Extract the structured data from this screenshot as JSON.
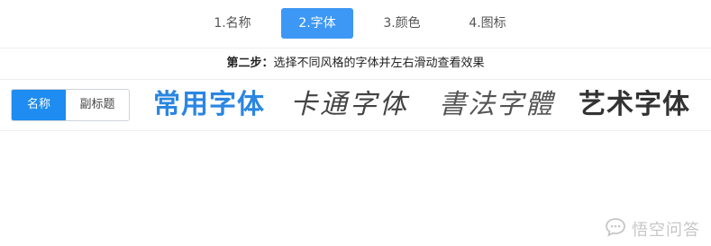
{
  "steps": [
    {
      "label": "1.名称",
      "active": false
    },
    {
      "label": "2.字体",
      "active": true
    },
    {
      "label": "3.颜色",
      "active": false
    },
    {
      "label": "4.图标",
      "active": false
    }
  ],
  "instruction": {
    "prefix": "第二步：",
    "text": "选择不同风格的字体并左右滑动查看效果"
  },
  "toggle": {
    "name_label": "名称",
    "subtitle_label": "副标题",
    "selected": "名称"
  },
  "font_samples": [
    {
      "label": "常用字体"
    },
    {
      "label": "卡通字体"
    },
    {
      "label": "書法字體"
    },
    {
      "label": "艺术字体"
    }
  ],
  "watermark": {
    "text": "悟空问答",
    "icon": "chat-bubble-icon"
  },
  "colors": {
    "accent": "#3d97f5",
    "toggle_active": "#1e8cf0",
    "common_font": "#2a86e0"
  }
}
